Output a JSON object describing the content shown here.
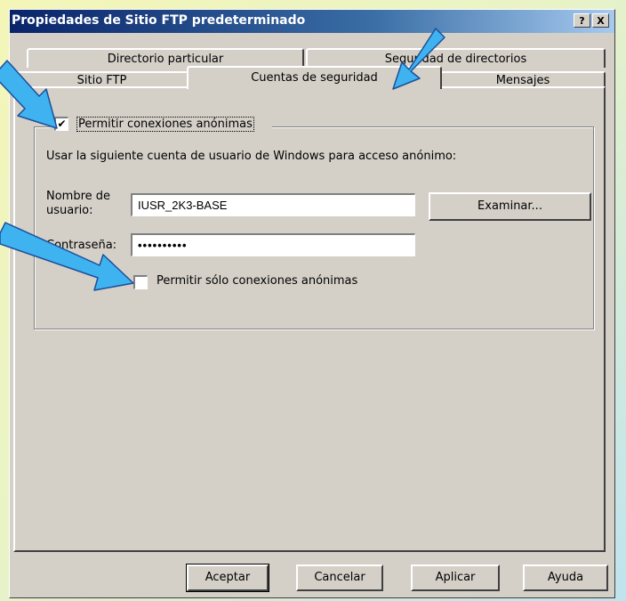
{
  "window": {
    "title": "Propiedades de Sitio FTP predeterminado",
    "help_button": "?",
    "close_button": "X"
  },
  "tabs": {
    "row_back": [
      "Directorio particular",
      "Seguridad de directorios"
    ],
    "row_front": [
      "Sitio FTP",
      "Cuentas de seguridad",
      "Mensajes"
    ],
    "active": "Cuentas de seguridad"
  },
  "anonymous": {
    "allow_label": "Permitir conexiones anónimas",
    "allow_checked": true,
    "description": "Usar la siguiente cuenta de usuario de Windows para acceso anónimo:",
    "username_label_line1": "Nombre de",
    "username_label_line2": "usuario:",
    "username_value": "IUSR_2K3-BASE",
    "browse_label": "Examinar...",
    "password_label": "Contraseña:",
    "password_value": "••••••••••",
    "only_anon_label": "Permitir sólo conexiones anónimas",
    "only_anon_checked": false
  },
  "footer": {
    "ok": "Aceptar",
    "cancel": "Cancelar",
    "apply": "Aplicar",
    "help": "Ayuda"
  },
  "colors": {
    "titlebar_start": "#0a246a",
    "face": "#d4d0c8",
    "callout_arrow": "#3fb3f0"
  }
}
